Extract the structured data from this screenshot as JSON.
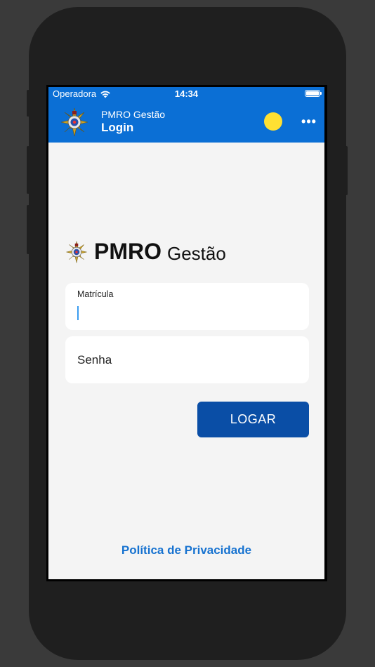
{
  "status_bar": {
    "carrier": "Operadora",
    "time": "14:34",
    "wifi_icon": "wifi-icon",
    "battery_icon": "battery-icon"
  },
  "header": {
    "app_name": "PMRO Gestão",
    "page_title": "Login",
    "logo_icon": "emblem-icon",
    "status_indicator_color": "#ffe033",
    "more_label": "•••",
    "more_icon": "more-options-icon"
  },
  "brand": {
    "strong": "PMRO",
    "light": "Gestão",
    "logo_icon": "emblem-icon"
  },
  "form": {
    "matricula_label": "Matrícula",
    "matricula_value": "",
    "senha_placeholder": "Senha",
    "senha_value": "",
    "submit_label": "LOGAR"
  },
  "footer": {
    "privacy_link": "Política de Privacidade"
  },
  "colors": {
    "header_bg": "#0b6fd5",
    "button_bg": "#0a4ea6",
    "link": "#1672d0",
    "screen_bg": "#f4f4f4"
  }
}
